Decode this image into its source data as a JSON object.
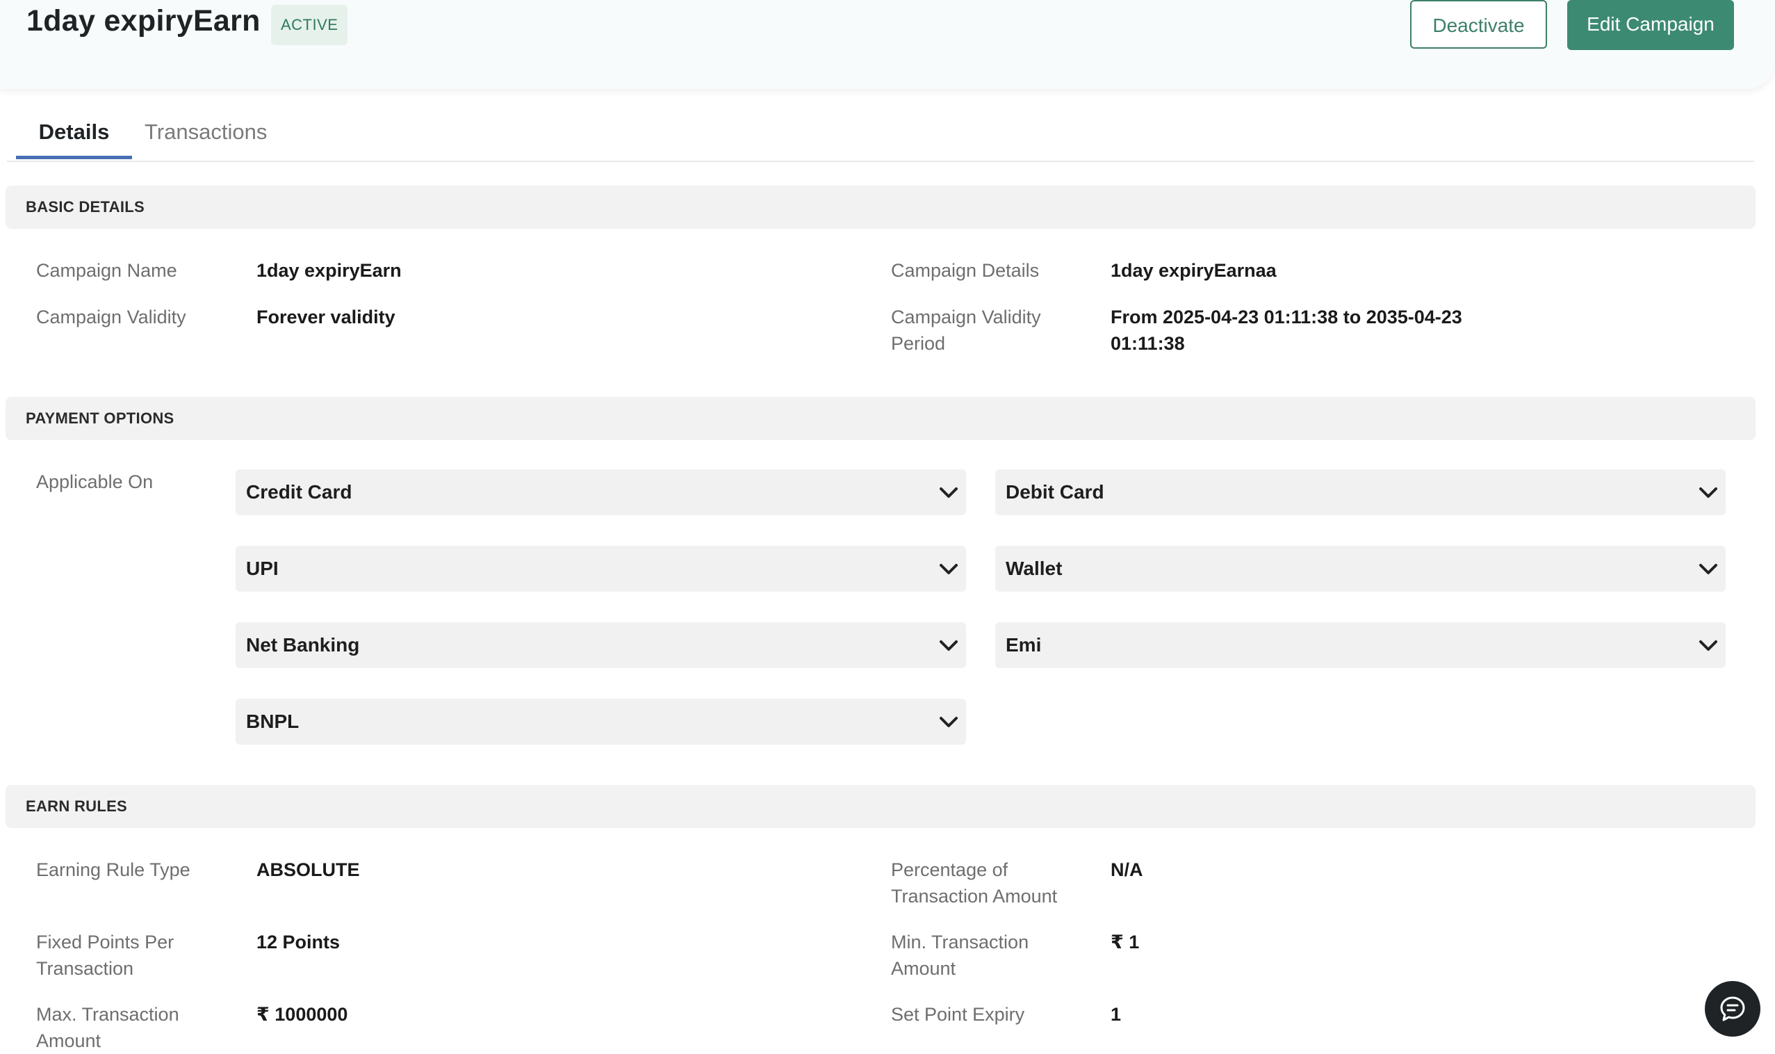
{
  "header": {
    "title": "1day expiryEarn",
    "status_badge": "ACTIVE",
    "deactivate_label": "Deactivate",
    "edit_label": "Edit Campaign"
  },
  "tabs": [
    {
      "label": "Details",
      "active": true
    },
    {
      "label": "Transactions",
      "active": false
    }
  ],
  "basic_details": {
    "heading": "BASIC DETAILS",
    "campaign_name_label": "Campaign Name",
    "campaign_name_value": "1day expiryEarn",
    "campaign_details_label": "Campaign Details",
    "campaign_details_value": "1day expiryEarnaa",
    "validity_label": "Campaign Validity",
    "validity_value": "Forever validity",
    "validity_period_label": "Campaign Validity Period",
    "validity_period_value": "From 2025-04-23 01:11:38 to 2035-04-23 01:11:38"
  },
  "payment_options": {
    "heading": "PAYMENT OPTIONS",
    "applicable_label": "Applicable On",
    "options": [
      "Credit Card",
      "Debit Card",
      "UPI",
      "Wallet",
      "Net Banking",
      "Emi",
      "BNPL"
    ]
  },
  "earn_rules": {
    "heading": "EARN RULES",
    "rule_type_label": "Earning Rule Type",
    "rule_type_value": "ABSOLUTE",
    "percentage_label": "Percentage of Transaction Amount",
    "percentage_value": "N/A",
    "fixed_points_label": "Fixed Points Per Transaction",
    "fixed_points_value": "12 Points",
    "min_txn_label": "Min. Transaction Amount",
    "min_txn_value": "₹ 1",
    "max_txn_label": "Max. Transaction Amount",
    "max_txn_value": "₹ 1000000",
    "point_expiry_label": "Set Point Expiry",
    "point_expiry_value": "1"
  },
  "colors": {
    "brand_green": "#3d8a72",
    "tab_underline": "#4a6fb5",
    "badge_bg": "#e6f1ec"
  },
  "icons": {
    "dropdown": "chevron-down-icon",
    "chat": "chat-icon"
  }
}
